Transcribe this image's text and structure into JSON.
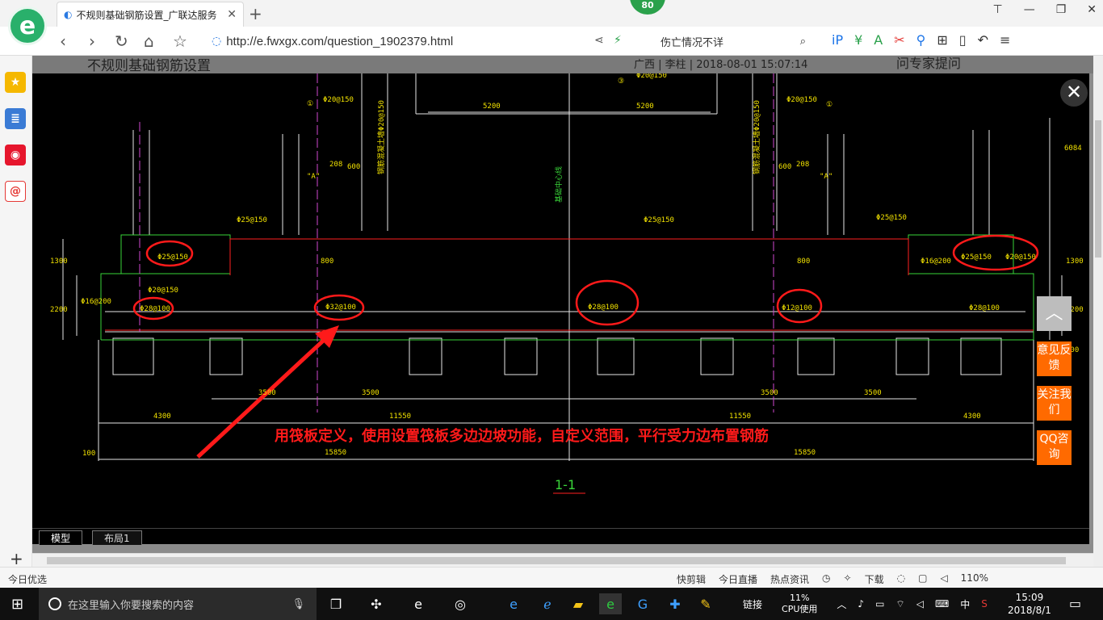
{
  "browser": {
    "tab_title": "不规则基础钢筋设置_广联达服务",
    "tab_close": "✕",
    "new_tab": "+",
    "badge": "80",
    "url": "http://e.fwxgx.com/question_1902379.html",
    "search_text": "伤亡情况不详",
    "window_controls": [
      "minimize-icon",
      "restore-icon",
      "close-icon"
    ]
  },
  "page": {
    "title": "不规则基础钢筋设置",
    "meta": "广西 | 李柱 | 2018-08-01 15:07:14",
    "ask_expert": "问专家提问"
  },
  "cad": {
    "annotation": "用筏板定义，使用设置筏板多边边坡功能，自定义范围，平行受力边布置钢筋",
    "section_label": "1-1",
    "tabs": [
      "模型",
      "布局1"
    ],
    "dims_bottom": [
      "4300",
      "11550",
      "11550",
      "4300"
    ],
    "dims_total": [
      "15850",
      "15850"
    ],
    "dims_mid": [
      "3500",
      "3500",
      "3500",
      "3500"
    ],
    "dims_top": [
      "5200",
      "5200"
    ],
    "dims_side": [
      "600",
      "208",
      "600",
      "208"
    ],
    "rebar_labels": [
      "Φ25@150",
      "Φ25@150",
      "Φ25@150",
      "Φ20@150",
      "Φ25@150",
      "Φ20@150",
      "Φ28@100",
      "Φ32@100",
      "Φ28@100",
      "Φ12@100",
      "Φ28@100",
      "Φ20@150",
      "Φ20@150",
      "Φ16@200",
      "Φ16@200"
    ],
    "dim_left": [
      "1300",
      "2200"
    ],
    "dim_right": [
      "1300",
      "2200",
      "6084"
    ],
    "vertical_text": [
      "钢筋混凝土墙Φ20@150",
      "钢筋混凝土墙Φ20@150",
      "基础中心线"
    ],
    "small_labels": [
      "\"A\"",
      "\"A\"",
      "800",
      "800",
      "100",
      "100",
      "①",
      "①",
      "③",
      "Φ20@150"
    ]
  },
  "floating": {
    "feedback": "意见反馈",
    "follow": "关注我们",
    "qq": "QQ咨询",
    "close": "✕",
    "top": "︿"
  },
  "statusbar": {
    "left": "今日优选",
    "items": [
      "快剪辑",
      "今日直播",
      "热点资讯",
      "下载",
      "110%"
    ]
  },
  "taskbar": {
    "search_placeholder": "在这里输入你要搜索的内容",
    "link": "链接",
    "cpu_percent": "11%",
    "cpu_label": "CPU使用",
    "ime": "中",
    "time": "15:09",
    "date": "2018/8/1"
  },
  "colors": {
    "cad_background": "#000000",
    "annotation_red": "#ff1a1a",
    "accent_orange": "#ff6a00",
    "brand_green": "#29b06b"
  }
}
